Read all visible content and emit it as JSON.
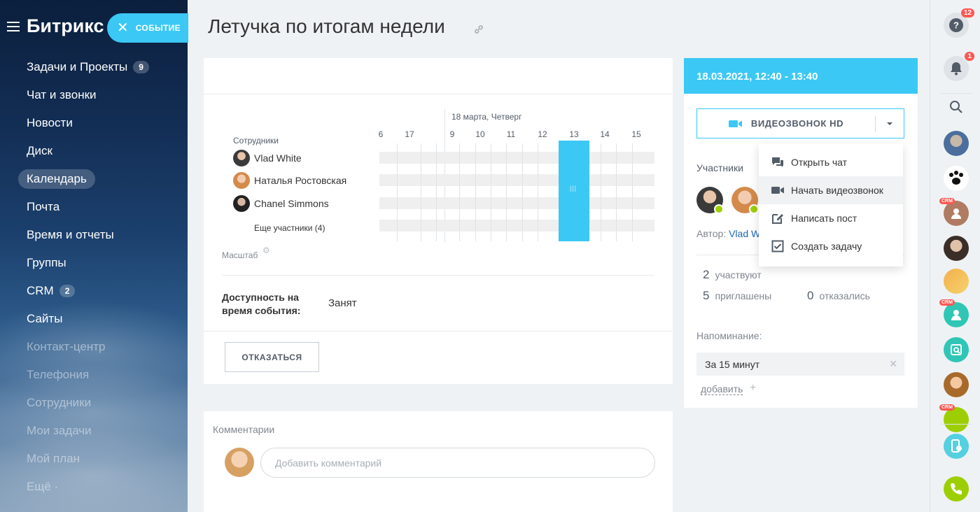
{
  "app": {
    "logo": "Битрикс",
    "event_button": "СОБЫТИЕ"
  },
  "sidebar": {
    "items": [
      {
        "label": "Задачи и Проекты",
        "badge": "9"
      },
      {
        "label": "Чат и звонки"
      },
      {
        "label": "Новости"
      },
      {
        "label": "Диск"
      },
      {
        "label": "Календарь",
        "active": true
      },
      {
        "label": "Почта"
      },
      {
        "label": "Время и отчеты"
      },
      {
        "label": "Группы"
      },
      {
        "label": "CRM",
        "badge": "2"
      },
      {
        "label": "Сайты"
      },
      {
        "label": "Контакт-центр"
      },
      {
        "label": "Телефония"
      },
      {
        "label": "Сотрудники"
      },
      {
        "label": "Мои задачи"
      },
      {
        "label": "Мой план"
      },
      {
        "label": "Ещё ·"
      }
    ]
  },
  "page": {
    "title": "Летучка по итогам недели"
  },
  "planner": {
    "date_label": "18 марта, Четверг",
    "hours": [
      "6",
      "17",
      "9",
      "10",
      "11",
      "12",
      "13",
      "14",
      "15"
    ],
    "employees_header": "Сотрудники",
    "employees": [
      {
        "name": "Vlad White"
      },
      {
        "name": "Наталья Ростовская"
      },
      {
        "name": "Chanel Simmons"
      }
    ],
    "more_participants": "Еще участники (4)",
    "scale_label": "Масштаб"
  },
  "availability": {
    "label": "Доступность на время события:",
    "value": "Занят"
  },
  "actions": {
    "decline": "ОТКАЗАТЬСЯ"
  },
  "comments": {
    "title": "Комментарии",
    "placeholder": "Добавить комментарий"
  },
  "event_panel": {
    "datetime": "18.03.2021, 12:40 - 13:40",
    "video_button": "ВИДЕОЗВОНОК HD",
    "participants_title": "Участники",
    "author_label": "Автор:",
    "author_name": "Vlad W",
    "stats": [
      {
        "count": "2",
        "label": "участвуют"
      },
      {
        "count": "5",
        "label": "приглашены"
      },
      {
        "count": "0",
        "label": "отказались"
      }
    ],
    "reminder_title": "Напоминание:",
    "reminder_value": "За 15 минут",
    "add_link": "добавить"
  },
  "dropdown_menu": {
    "items": [
      {
        "label": "Открыть чат",
        "icon": "chat-icon"
      },
      {
        "label": "Начать видеозвонок",
        "icon": "video-camera-icon"
      },
      {
        "label": "Написать пост",
        "icon": "edit-icon"
      },
      {
        "label": "Создать задачу",
        "icon": "task-checkbox-icon"
      }
    ]
  },
  "rail": {
    "help_badge": "12",
    "notif_badge": "1",
    "crm_tag": "CRM"
  },
  "colors": {
    "accent": "#3bc8f5",
    "link": "#2067b0",
    "badge": "#ff5752",
    "green": "#9dcf00"
  }
}
